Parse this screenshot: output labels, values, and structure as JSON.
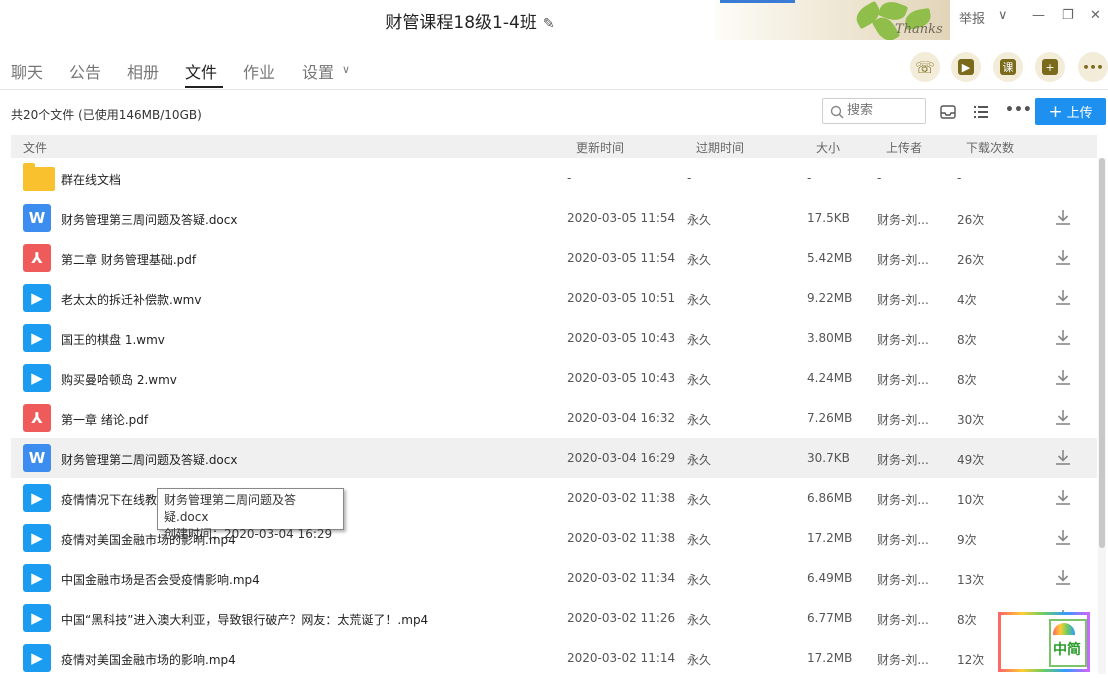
{
  "window": {
    "title": "财管课程18级1-4班",
    "report": "举报",
    "banner_text": "Thanks"
  },
  "tabs": [
    "聊天",
    "公告",
    "相册",
    "文件",
    "作业",
    "设置"
  ],
  "active_tab": "文件",
  "round_buttons": [
    {
      "name": "call",
      "glyph": "☏"
    },
    {
      "name": "video",
      "glyph": "▶"
    },
    {
      "name": "course",
      "glyph": "课"
    },
    {
      "name": "add-app",
      "glyph": "+"
    },
    {
      "name": "more",
      "glyph": "•••"
    }
  ],
  "toolbar": {
    "count": "共20个文件 (已使用146MB/10GB)",
    "search_placeholder": "搜索",
    "upload_label": "上传"
  },
  "columns": {
    "file": "文件",
    "updated": "更新时间",
    "expires": "过期时间",
    "size": "大小",
    "uploader": "上传者",
    "downloads": "下载次数"
  },
  "files": [
    {
      "type": "folder",
      "name": "群在线文档",
      "updated": "-",
      "expires": "-",
      "size": "-",
      "uploader": "-",
      "downloads": "-"
    },
    {
      "type": "word",
      "name": "财务管理第三周问题及答疑.docx",
      "updated": "2020-03-05 11:54",
      "expires": "永久",
      "size": "17.5KB",
      "uploader": "财务-刘...",
      "downloads": "26次"
    },
    {
      "type": "pdf",
      "name": "第二章 财务管理基础.pdf",
      "updated": "2020-03-05 11:54",
      "expires": "永久",
      "size": "5.42MB",
      "uploader": "财务-刘...",
      "downloads": "26次"
    },
    {
      "type": "video",
      "name": "老太太的拆迁补偿款.wmv",
      "updated": "2020-03-05 10:51",
      "expires": "永久",
      "size": "9.22MB",
      "uploader": "财务-刘...",
      "downloads": "4次"
    },
    {
      "type": "video",
      "name": "国王的棋盘 1.wmv",
      "updated": "2020-03-05 10:43",
      "expires": "永久",
      "size": "3.80MB",
      "uploader": "财务-刘...",
      "downloads": "8次"
    },
    {
      "type": "video",
      "name": "购买曼哈顿岛 2.wmv",
      "updated": "2020-03-05 10:43",
      "expires": "永久",
      "size": "4.24MB",
      "uploader": "财务-刘...",
      "downloads": "8次"
    },
    {
      "type": "pdf",
      "name": "第一章 绪论.pdf",
      "updated": "2020-03-04 16:32",
      "expires": "永久",
      "size": "7.26MB",
      "uploader": "财务-刘...",
      "downloads": "30次"
    },
    {
      "type": "word",
      "name": "财务管理第二周问题及答疑.docx",
      "updated": "2020-03-04 16:29",
      "expires": "永久",
      "size": "30.7KB",
      "uploader": "财务-刘...",
      "downloads": "49次"
    },
    {
      "type": "video",
      "name": "疫情情况下在线教",
      "updated": "2020-03-02 11:38",
      "expires": "永久",
      "size": "6.86MB",
      "uploader": "财务-刘...",
      "downloads": "10次"
    },
    {
      "type": "video",
      "name": "疫情对美国金融市场的影响.mp4",
      "updated": "2020-03-02 11:38",
      "expires": "永久",
      "size": "17.2MB",
      "uploader": "财务-刘...",
      "downloads": "9次"
    },
    {
      "type": "video",
      "name": "中国金融市场是否会受疫情影响.mp4",
      "updated": "2020-03-02 11:34",
      "expires": "永久",
      "size": "6.49MB",
      "uploader": "财务-刘...",
      "downloads": "13次"
    },
    {
      "type": "video",
      "name": "中国“黑科技”进入澳大利亚，导致银行破产？网友：太荒诞了！.mp4",
      "updated": "2020-03-02 11:26",
      "expires": "永久",
      "size": "6.77MB",
      "uploader": "财务-刘...",
      "downloads": "8次"
    },
    {
      "type": "video",
      "name": "疫情对美国金融市场的影响.mp4",
      "updated": "2020-03-02 11:14",
      "expires": "永久",
      "size": "17.2MB",
      "uploader": "财务-刘...",
      "downloads": "12次"
    }
  ],
  "hovered_row": 7,
  "tooltip": {
    "name": "财务管理第二周问题及答疑.docx",
    "created": "创建时间：2020-03-04 16:29"
  },
  "ime": {
    "label": "中简"
  }
}
